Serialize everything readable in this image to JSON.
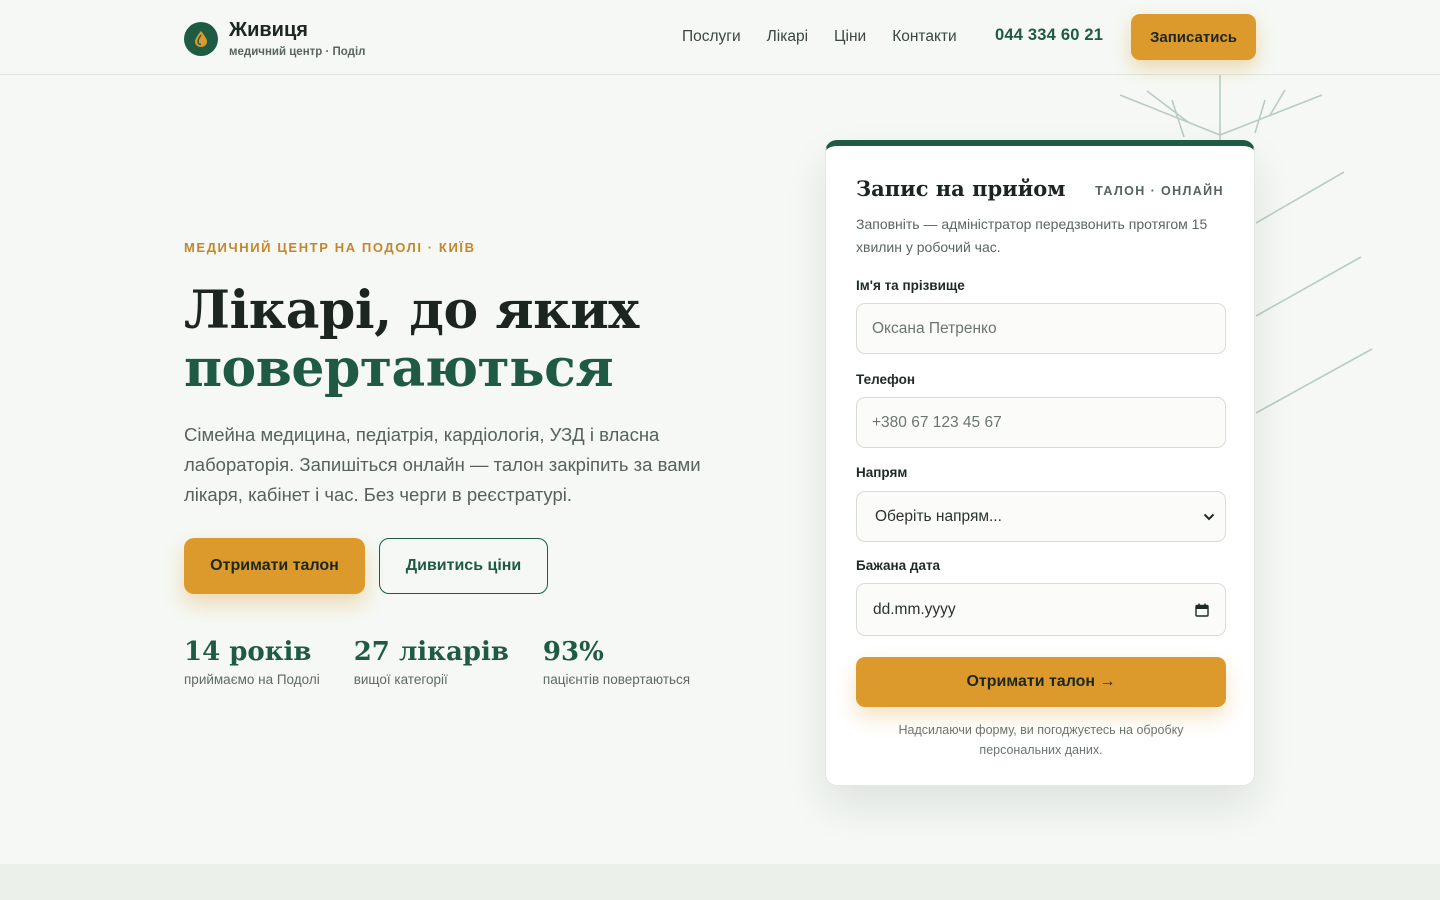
{
  "brand": {
    "name": "Живиця",
    "subtitle": "медичний центр · Поділ",
    "icon": "drop-icon",
    "colors": {
      "primary": "#1f5a43",
      "accent": "#dc9a2d",
      "background": "#f5f8f4"
    }
  },
  "nav": {
    "items": [
      {
        "label": "Послуги"
      },
      {
        "label": "Лікарі"
      },
      {
        "label": "Ціни"
      },
      {
        "label": "Контакти"
      }
    ],
    "phone": "044 334 60 21",
    "cta_label": "Записатись"
  },
  "hero": {
    "eyebrow": "МЕДИЧНИЙ ЦЕНТР НА ПОДОЛІ · КИЇВ",
    "title_line1": "Лікарі, до яких",
    "title_line2": "повертаються",
    "lead": "Сімейна медицина, педіатрія, кардіологія, УЗД і власна лабораторія. Запишіться онлайн — талон закріпить за вами лікаря, кабінет і час. Без черги в реєстратурі.",
    "primary_button": "Отримати талон",
    "secondary_button": "Дивитись ціни",
    "stats": [
      {
        "value": "14 років",
        "label": "приймаємо на Подолі"
      },
      {
        "value": "27 лікарів",
        "label": "вищої категорії"
      },
      {
        "value": "93%",
        "label": "пацієнтів повертаються"
      }
    ]
  },
  "form": {
    "title": "Запис на прийом",
    "tag": "ТАЛОН · ОНЛАЙН",
    "description": "Заповніть — адміністратор передзвонить протягом 15 хвилин у робочий час.",
    "name_label": "Ім'я та прізвище",
    "name_placeholder": "Оксана Петренко",
    "phone_label": "Телефон",
    "phone_placeholder": "+380 67 123 45 67",
    "direction_label": "Напрям",
    "direction_value": "Оберіть напрям...",
    "date_label": "Бажана дата",
    "date_placeholder": "dd.mm.yyyy",
    "submit_label": "Отримати талон →",
    "consent": "Надсилаючи форму, ви погоджуєтесь на обробку персональних даних."
  }
}
